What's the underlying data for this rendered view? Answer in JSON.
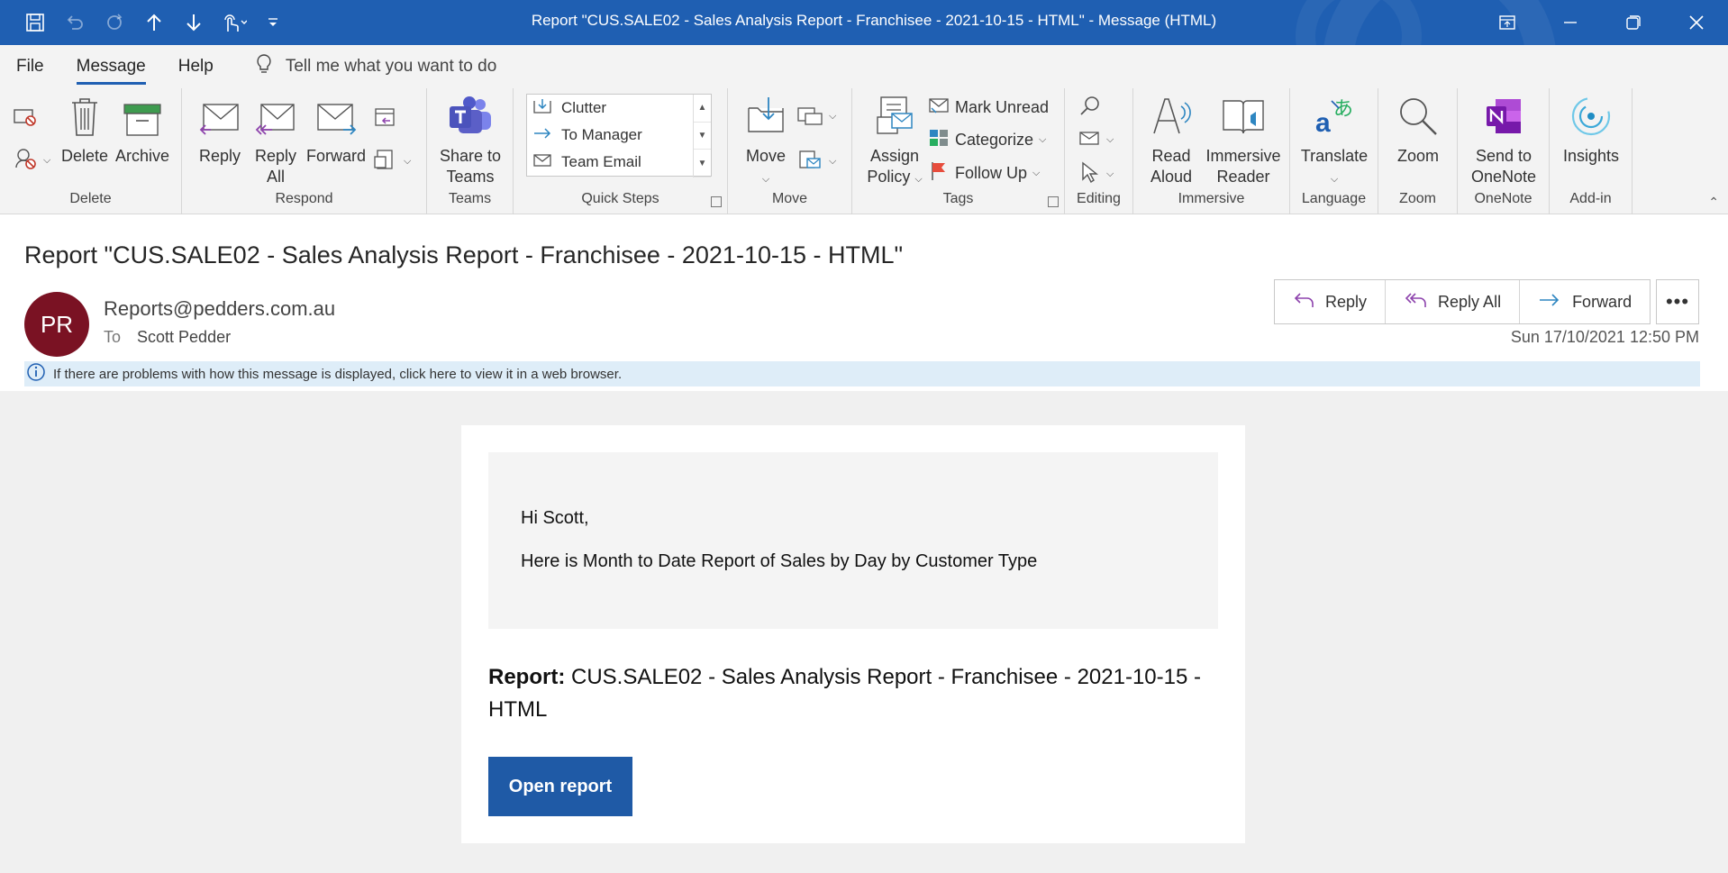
{
  "window": {
    "title": "Report \"CUS.SALE02 - Sales Analysis Report - Franchisee - 2021-10-15 - HTML\"  -  Message (HTML)"
  },
  "menu": {
    "items": [
      "File",
      "Message",
      "Help"
    ],
    "tell_me": "Tell me what you want to do"
  },
  "ribbon": {
    "delete_group": {
      "label": "Delete",
      "delete": "Delete",
      "archive": "Archive"
    },
    "respond_group": {
      "label": "Respond",
      "reply": "Reply",
      "reply_all_1": "Reply",
      "reply_all_2": "All",
      "forward": "Forward"
    },
    "teams_group": {
      "label": "Teams",
      "share_1": "Share to",
      "share_2": "Teams"
    },
    "quicksteps_group": {
      "label": "Quick Steps",
      "items": [
        "Clutter",
        "To Manager",
        "Team Email"
      ]
    },
    "move_group": {
      "label": "Move",
      "move": "Move"
    },
    "tags_group": {
      "label": "Tags",
      "assign_1": "Assign",
      "assign_2": "Policy",
      "mark_unread": "Mark Unread",
      "categorize": "Categorize",
      "follow_up": "Follow Up"
    },
    "editing_group": {
      "label": "Editing"
    },
    "immersive_group": {
      "label": "Immersive",
      "read_1": "Read",
      "read_2": "Aloud",
      "reader_1": "Immersive",
      "reader_2": "Reader"
    },
    "language_group": {
      "label": "Language",
      "translate": "Translate"
    },
    "zoom_group": {
      "label": "Zoom",
      "zoom": "Zoom"
    },
    "onenote_group": {
      "label": "OneNote",
      "send_1": "Send to",
      "send_2": "OneNote"
    },
    "addin_group": {
      "label": "Add-in",
      "insights": "Insights"
    }
  },
  "message": {
    "subject": "Report \"CUS.SALE02 - Sales Analysis Report - Franchisee - 2021-10-15 - HTML\"",
    "avatar_initials": "PR",
    "from": "Reports@pedders.com.au",
    "to_label": "To",
    "to": "Scott Pedder",
    "datetime": "Sun 17/10/2021 12:50 PM",
    "info": "If there are problems with how this message is displayed, click here to view it in a web browser.",
    "actions": {
      "reply": "Reply",
      "reply_all": "Reply All",
      "forward": "Forward"
    }
  },
  "body": {
    "greeting": "Hi Scott,",
    "intro": "Here is Month to Date Report of Sales by Day by Customer Type",
    "report_label": "Report:",
    "report_name": "CUS.SALE02 - Sales Analysis Report - Franchisee - 2021-10-15 - HTML",
    "open_button": "Open report"
  },
  "colors": {
    "titlebar": "#1f5fb2",
    "avatar": "#7a1223",
    "open_button": "#1f5aa6",
    "infobar": "#deedf8"
  }
}
